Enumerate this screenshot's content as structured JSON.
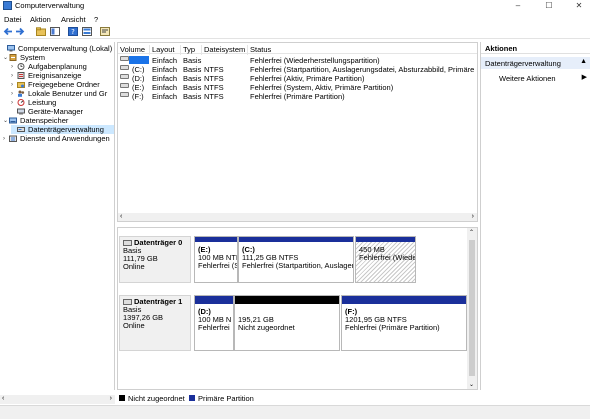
{
  "window": {
    "title": "Computerverwaltung",
    "minimize": "–",
    "maximize": "☐",
    "close": "✕"
  },
  "menu": [
    "Datei",
    "Aktion",
    "Ansicht",
    "?"
  ],
  "tree": {
    "items": [
      {
        "label": "Computerverwaltung (Lokal)"
      },
      {
        "label": "System"
      },
      {
        "label": "Aufgabenplanung"
      },
      {
        "label": "Ereignisanzeige"
      },
      {
        "label": "Freigegebene Ordner"
      },
      {
        "label": "Lokale Benutzer und Gr"
      },
      {
        "label": "Leistung"
      },
      {
        "label": "Geräte-Manager"
      },
      {
        "label": "Datenspeicher"
      },
      {
        "label": "Datenträgerverwaltung"
      },
      {
        "label": "Dienste und Anwendungen"
      }
    ]
  },
  "volumes": {
    "headers": [
      "Volume",
      "Layout",
      "Typ",
      "Dateisystem",
      "Status"
    ],
    "rows": [
      [
        "",
        "Einfach",
        "Basis",
        "",
        "Fehlerfrei (Wiederherstellungspartition)"
      ],
      [
        "(C:)",
        "Einfach",
        "Basis",
        "NTFS",
        "Fehlerfrei (Startpartition, Auslagerungsdatei, Absturzabbild, Primäre Pa"
      ],
      [
        "(D:)",
        "Einfach",
        "Basis",
        "NTFS",
        "Fehlerfrei (Aktiv, Primäre Partition)"
      ],
      [
        "(E:)",
        "Einfach",
        "Basis",
        "NTFS",
        "Fehlerfrei (System, Aktiv, Primäre Partition)"
      ],
      [
        "(F:)",
        "Einfach",
        "Basis",
        "NTFS",
        "Fehlerfrei (Primäre Partition)"
      ]
    ]
  },
  "disks": [
    {
      "name": "Datenträger 0",
      "type": "Basis",
      "size": "111,79 GB",
      "state": "Online",
      "partitions": [
        {
          "line1": "(E:)",
          "line2": "100 MB NTI",
          "line3": "Fehlerfrei (S"
        },
        {
          "line1": "(C:)",
          "line2": "111,25 GB NTFS",
          "line3": "Fehlerfrei (Startpartition, Auslager"
        },
        {
          "line1": "",
          "line2": "450 MB",
          "line3": "Fehlerfrei (Wiede"
        }
      ]
    },
    {
      "name": "Datenträger 1",
      "type": "Basis",
      "size": "1397,26 GB",
      "state": "Online",
      "partitions": [
        {
          "line1": "(D:)",
          "line2": "100 MB N",
          "line3": "Fehlerfrei"
        },
        {
          "line1": "",
          "line2": "195,21 GB",
          "line3": "Nicht zugeordnet"
        },
        {
          "line1": "(F:)",
          "line2": "1201,95 GB NTFS",
          "line3": "Fehlerfrei (Primäre Partition)"
        }
      ]
    }
  ],
  "legend": [
    "Nicht zugeordnet",
    "Primäre Partition"
  ],
  "actions": {
    "header": "Aktionen",
    "section": "Datenträgerverwaltung",
    "more": "Weitere Aktionen"
  },
  "colors": {
    "primary": "#1a2f9a",
    "unallocated": "#000000",
    "selection": "#cce8ff"
  }
}
